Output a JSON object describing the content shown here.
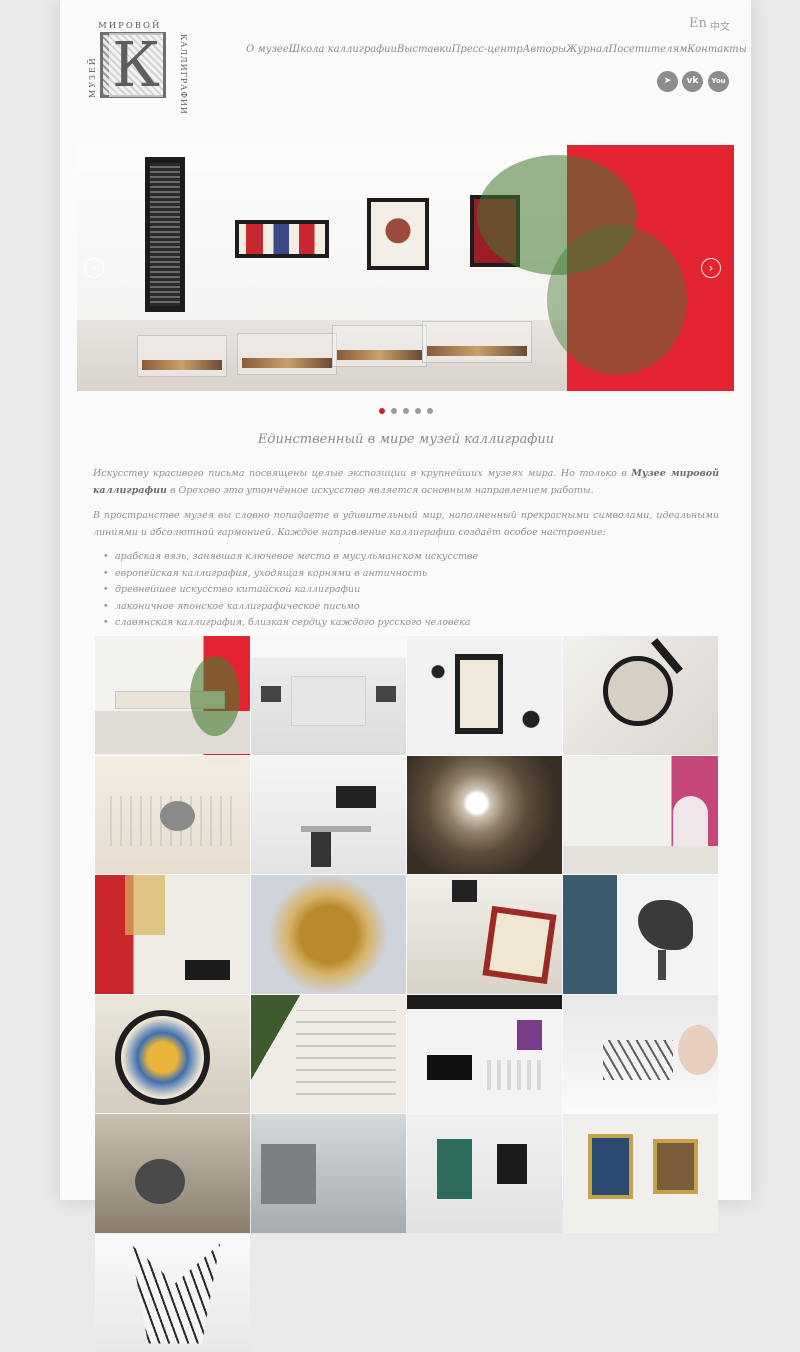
{
  "header": {
    "logo": {
      "top_text": "МИРОВОЙ",
      "left_text": "МУЗЕЙ",
      "right_text": "КАЛЛИГРАФИИ",
      "letter": "К"
    },
    "lang_en": "En",
    "lang_zh": "中文",
    "nav": [
      "О музее",
      "Школа каллиграфии",
      "Выставки",
      "Пресс-центр",
      "Авторы",
      "Журнал",
      "Посетителям",
      "Контакты"
    ],
    "social": [
      {
        "icon": "telegram-icon",
        "glyph": "➤"
      },
      {
        "icon": "vk-icon",
        "glyph": "vk"
      },
      {
        "icon": "youtube-icon",
        "glyph": "You"
      }
    ]
  },
  "slider": {
    "prev_glyph": "‹",
    "next_glyph": "›",
    "slide_count": 5,
    "active_slide": 1
  },
  "content": {
    "heading": "Единственный в мире музей каллиграфии",
    "p1_before": "Искусству красивого письма посвящены целые экспозиции в крупнейших музеях мира. Но только в ",
    "p1_bold": "Музее мировой каллиграфии",
    "p1_after": " в Орехово это утончённое искусство является основным направлением работы.",
    "p2": "В пространстве музея вы словно попадаете в удивительный мир, наполненный прекрасными символами, идеальными линиями и абсолютной гармонией. Каждое направление каллиграфии создаёт особое настроение:",
    "list": [
      "арабская вязь, занявшая ключевое место в мусульманском искусстве",
      "европейская каллиграфия, уходящая корнями в античность",
      "древнейшее искусство китайской каллиграфии",
      "лаконичное японское каллиграфическое письмо",
      "славянская каллиграфия, близкая сердцу каждого русского человека"
    ]
  },
  "colors": {
    "accent": "#d4202e",
    "text": "#8f8f8f",
    "social": "#8d8d8d"
  },
  "gallery": [
    {
      "name": "exhibition-hall-red-wall"
    },
    {
      "name": "white-gallery-corridor"
    },
    {
      "name": "calligraphy-frame-ink-splash"
    },
    {
      "name": "magnifying-glass"
    },
    {
      "name": "calligraphy-pen-nib"
    },
    {
      "name": "desk-with-monitor"
    },
    {
      "name": "spiral-tunnel-letters"
    },
    {
      "name": "pink-arch-room"
    },
    {
      "name": "exhibition-with-piano"
    },
    {
      "name": "gold-ink-lettering"
    },
    {
      "name": "framed-manuscript"
    },
    {
      "name": "bronze-sculpture"
    },
    {
      "name": "magnifier-over-calligraphy"
    },
    {
      "name": "embossed-paper-text"
    },
    {
      "name": "concert-hall-piano"
    },
    {
      "name": "hand-writing-calligraphy"
    },
    {
      "name": "inkwell-and-quill"
    },
    {
      "name": "ne-lettering-tile"
    },
    {
      "name": "gallery-green-frames"
    },
    {
      "name": "gilded-frames-wall"
    },
    {
      "name": "paper-sculpture"
    }
  ]
}
